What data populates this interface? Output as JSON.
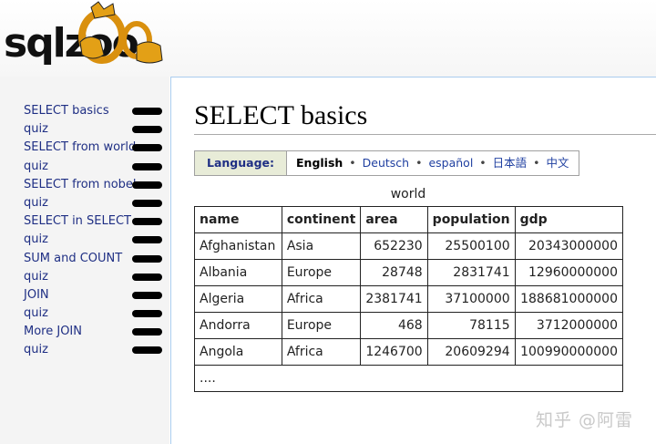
{
  "logo": {
    "text": "sqlzoo"
  },
  "page": {
    "title": "SELECT basics"
  },
  "language": {
    "label": "Language:",
    "current": "English",
    "options": [
      "Deutsch",
      "español",
      "日本語",
      "中文"
    ]
  },
  "table": {
    "caption": "world",
    "columns": [
      "name",
      "continent",
      "area",
      "population",
      "gdp"
    ],
    "rows": [
      [
        "Afghanistan",
        "Asia",
        "652230",
        "25500100",
        "20343000000"
      ],
      [
        "Albania",
        "Europe",
        "28748",
        "2831741",
        "12960000000"
      ],
      [
        "Algeria",
        "Africa",
        "2381741",
        "37100000",
        "188681000000"
      ],
      [
        "Andorra",
        "Europe",
        "468",
        "78115",
        "3712000000"
      ],
      [
        "Angola",
        "Africa",
        "1246700",
        "20609294",
        "100990000000"
      ]
    ],
    "more": "...."
  },
  "sidebar": {
    "items": [
      {
        "label": "SELECT basics"
      },
      {
        "label": "quiz"
      },
      {
        "label": "SELECT from world"
      },
      {
        "label": "quiz"
      },
      {
        "label": "SELECT from nobel"
      },
      {
        "label": "quiz"
      },
      {
        "label": "SELECT in SELECT"
      },
      {
        "label": "quiz"
      },
      {
        "label": "SUM and COUNT"
      },
      {
        "label": "quiz"
      },
      {
        "label": "JOIN"
      },
      {
        "label": "quiz"
      },
      {
        "label": "More JOIN"
      },
      {
        "label": "quiz"
      }
    ]
  },
  "watermark": "知乎 @阿雷"
}
